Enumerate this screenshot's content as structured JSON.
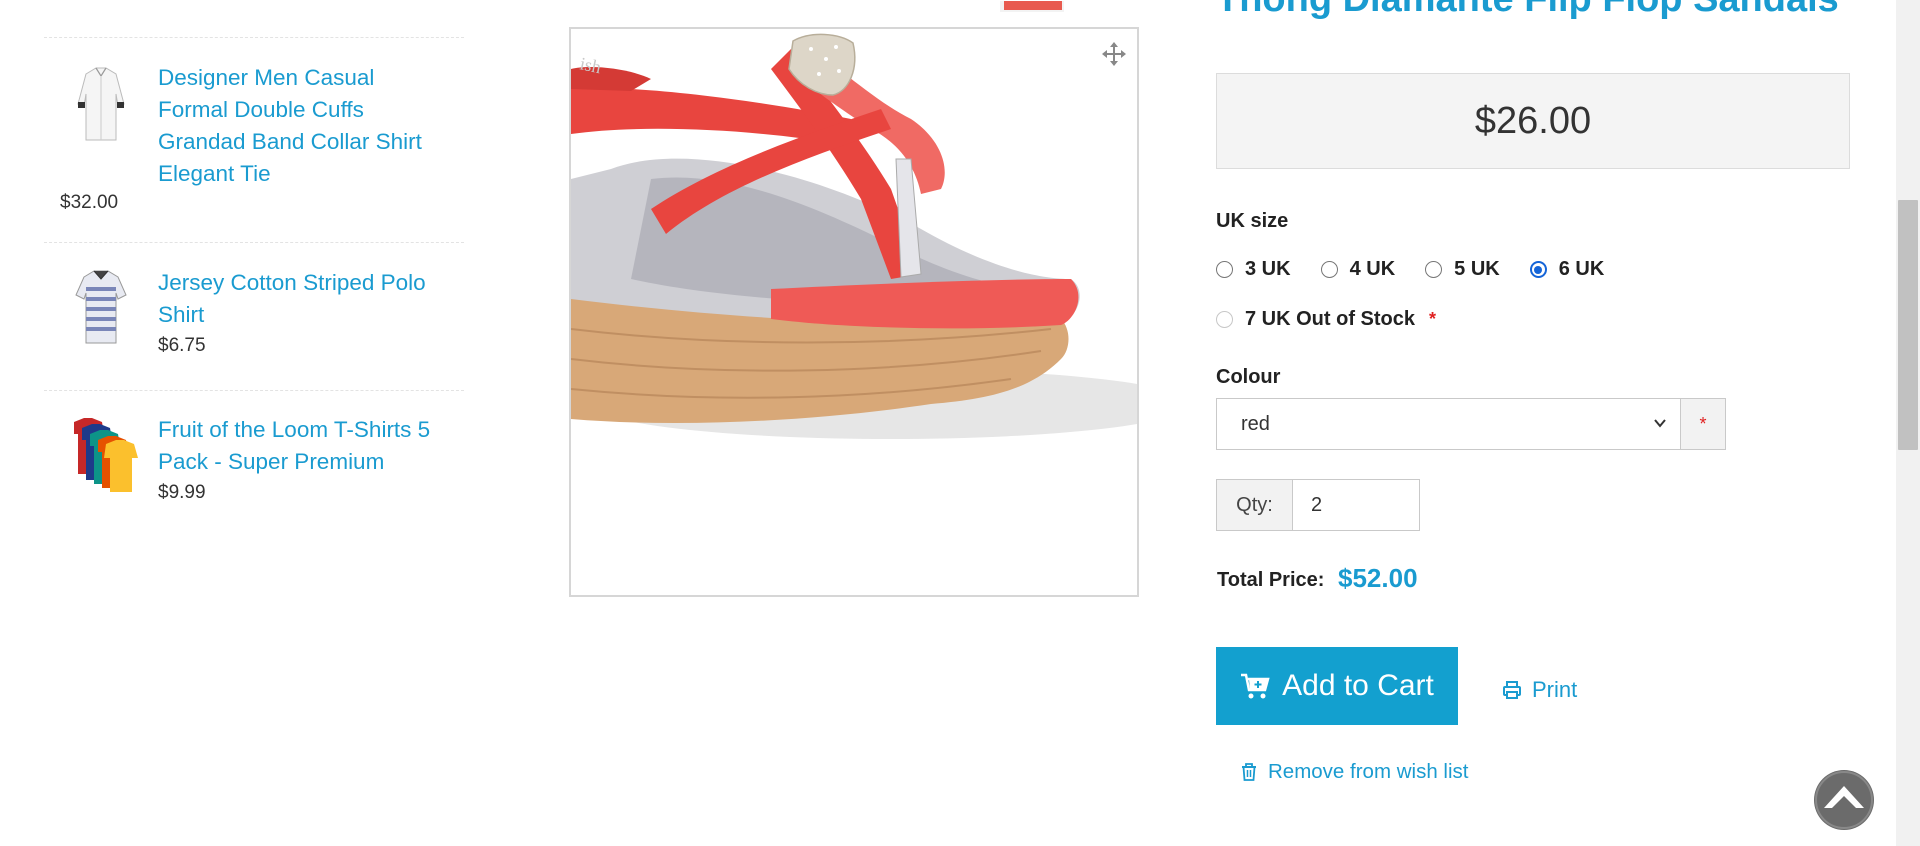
{
  "sidebar": {
    "items": [
      {
        "title": "Designer Men Casual Formal Double Cuffs Grandad Band Collar Shirt Elegant Tie",
        "price": "$32.00",
        "thumb_icon": "white-shirt-image"
      },
      {
        "title": "Jersey Cotton Striped Polo Shirt",
        "price": "$6.75",
        "thumb_icon": "striped-polo-image"
      },
      {
        "title": "Fruit of the Loom T-Shirts 5 Pack - Super Premium",
        "price": "$9.99",
        "thumb_icon": "tshirt-pack-image"
      }
    ]
  },
  "product": {
    "title": "Thong Diamante Flip Flop Sandals",
    "price": "$26.00",
    "image_icon": "red-wedge-sandal-image"
  },
  "options": {
    "size_label": "UK size",
    "sizes": [
      {
        "label": "3 UK",
        "checked": false
      },
      {
        "label": "4 UK",
        "checked": false
      },
      {
        "label": "5 UK",
        "checked": false
      },
      {
        "label": "6 UK",
        "checked": true
      },
      {
        "label": "7 UK Out of Stock",
        "checked": false,
        "disabled": true
      }
    ],
    "required_marker": "*",
    "colour_label": "Colour",
    "colour_selected": "red"
  },
  "qty": {
    "label": "Qty:",
    "value": "2"
  },
  "total": {
    "label": "Total Price:",
    "value": "$52.00"
  },
  "actions": {
    "add_to_cart": "Add to Cart",
    "print": "Print",
    "remove_wishlist": "Remove from wish list"
  },
  "colors": {
    "accent": "#1a9bd0",
    "button": "#13a0cf",
    "required": "#e02020"
  }
}
